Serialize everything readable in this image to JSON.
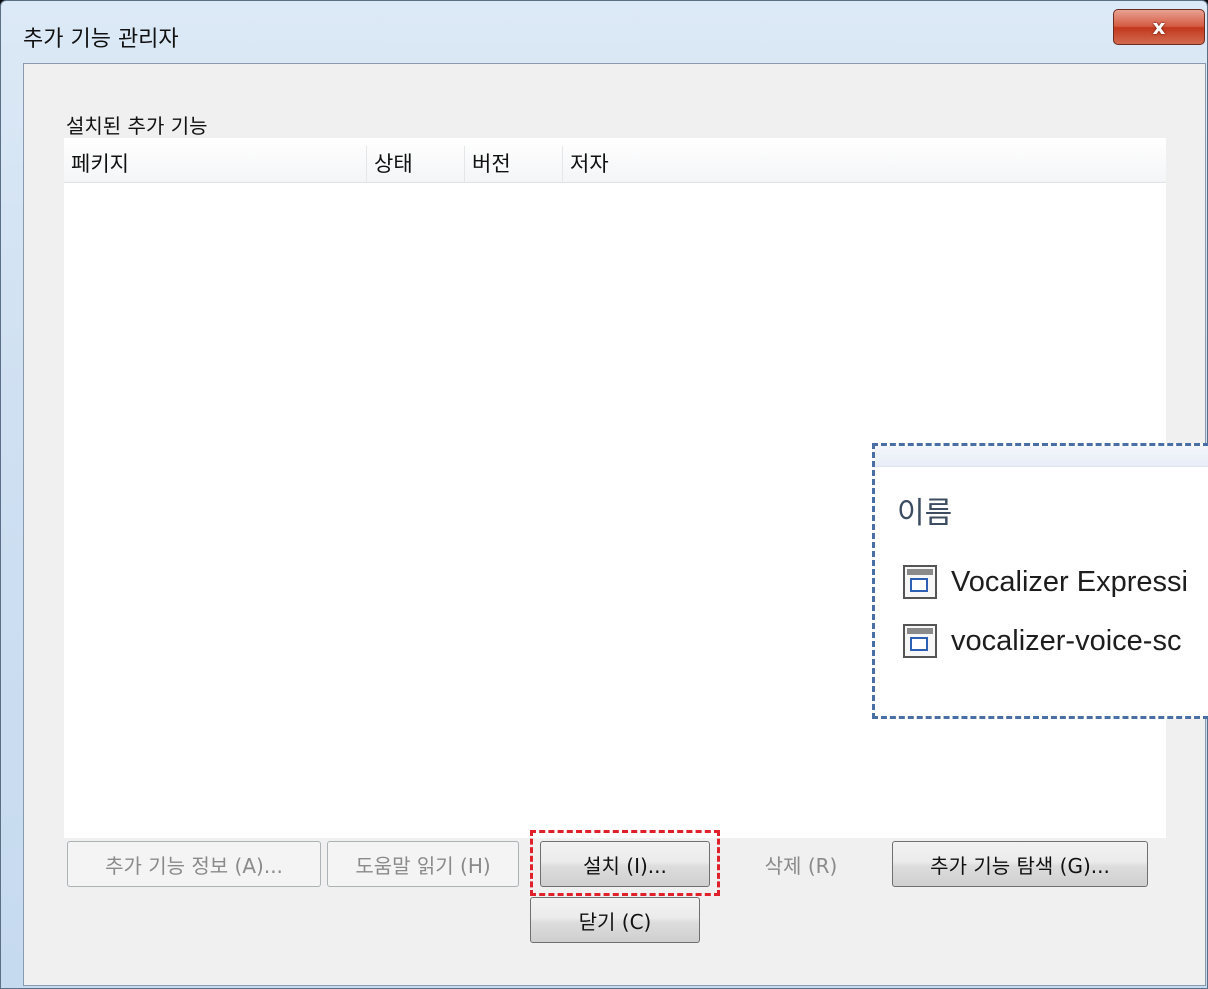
{
  "window": {
    "title": "추가 기능 관리자",
    "close_label": "x"
  },
  "section": {
    "label": "설치된 추가 기능"
  },
  "table": {
    "columns": [
      "페키지",
      "상태",
      "버전",
      "저자"
    ],
    "rows": []
  },
  "buttons": {
    "addon_info": "추가 기능 정보 (A)...",
    "help": "도움말 읽기 (H)",
    "install": "설치 (I)...",
    "remove": "삭제 (R)",
    "explore": "추가 기능 탐색 (G)...",
    "close": "닫기 (C)"
  },
  "callout": {
    "header": "이름",
    "files": [
      {
        "name": "Vocalizer Expressi",
        "icon": "installer-file-icon"
      },
      {
        "name": "vocalizer-voice-sc",
        "icon": "installer-file-icon"
      }
    ]
  }
}
